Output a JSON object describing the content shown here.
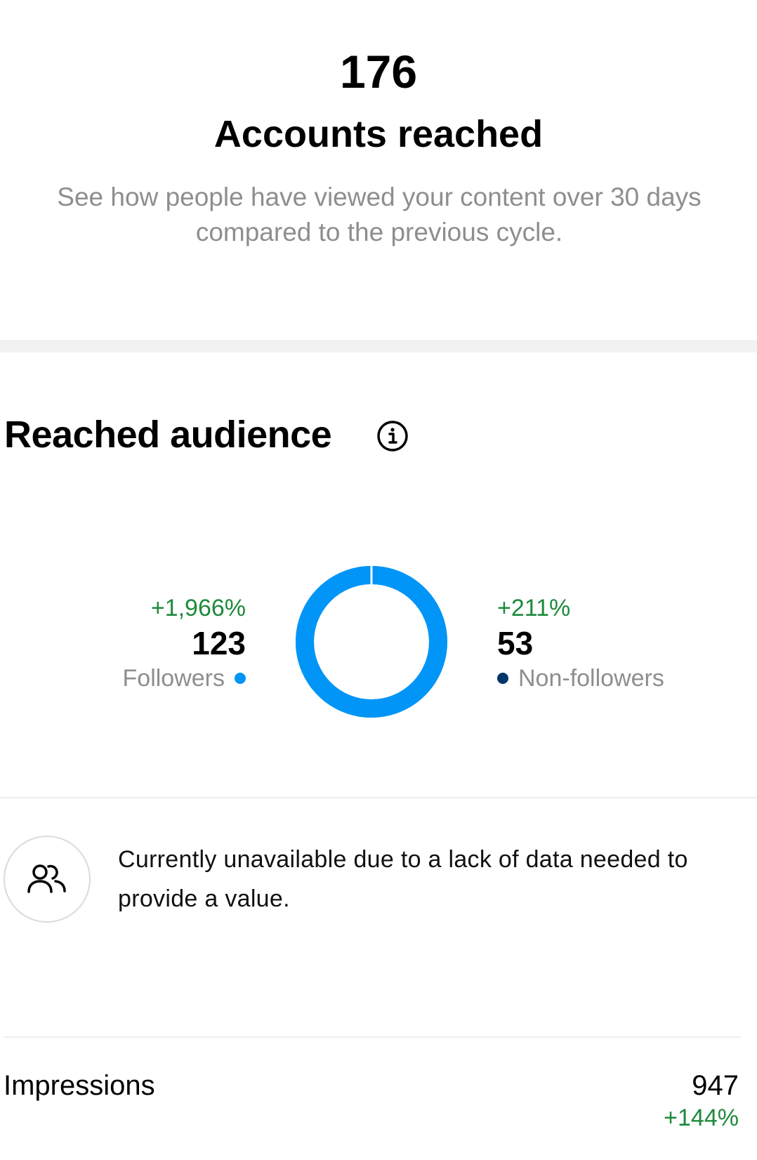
{
  "hero": {
    "count": "176",
    "title": "Accounts reached",
    "description": "See how people have viewed your content over 30 days compared to the previous cycle."
  },
  "reached_audience": {
    "title": "Reached audience",
    "info_icon": "info-icon",
    "followers": {
      "change": "+1,966%",
      "value": "123",
      "label": "Followers",
      "color": "#0095f6"
    },
    "non_followers": {
      "change": "+211%",
      "value": "53",
      "label": "Non-followers",
      "color": "#00376b"
    },
    "donut": {
      "followers_share": 1.0,
      "track_color": "#0095f6"
    }
  },
  "audience_note": {
    "icon": "people-icon",
    "text": "Currently unavailable due to a lack of data needed to provide a value."
  },
  "impressions": {
    "label": "Impressions",
    "value": "947",
    "change": "+144%"
  },
  "colors": {
    "positive": "#1e8a3c",
    "secondary_text": "#8e8e8e",
    "divider": "#eeeeee"
  }
}
